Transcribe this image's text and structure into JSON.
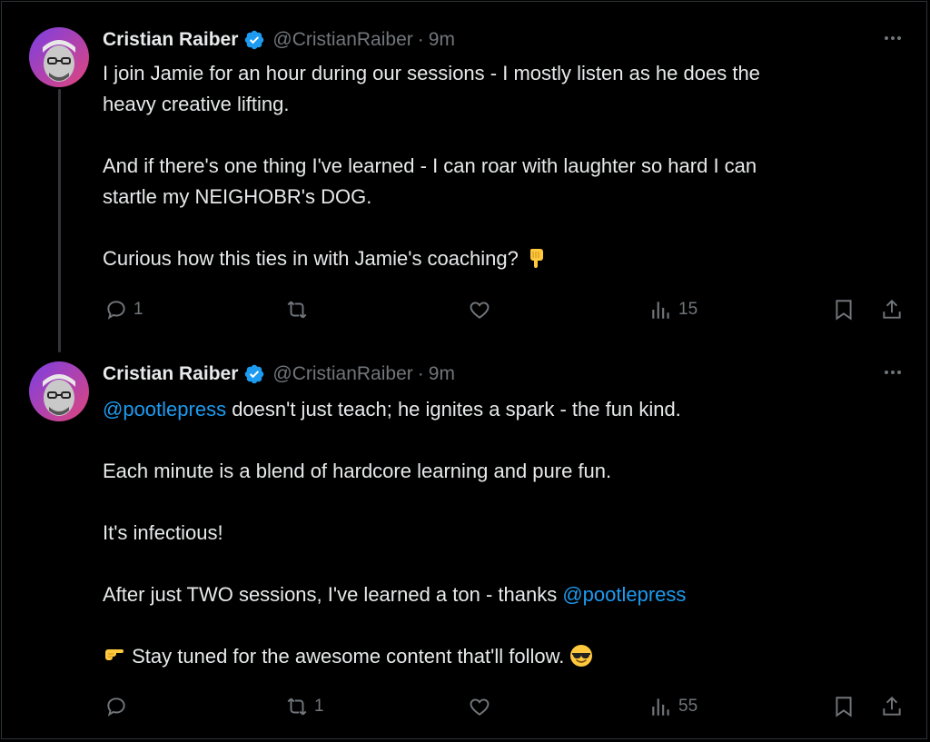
{
  "tweets": [
    {
      "author": "Cristian Raiber",
      "handle": "@CristianRaiber",
      "time": "9m",
      "paragraphs": [
        {
          "parts": [
            "I join Jamie for an hour during our sessions - I mostly listen as he does the",
            "heavy creative lifting."
          ]
        },
        {
          "parts": [
            "And if there's one thing I've learned - I can roar with laughter so hard I can",
            "startle my NEIGHOBR's DOG."
          ]
        },
        {
          "parts": [
            "Curious how this ties in with Jamie's coaching?"
          ]
        }
      ],
      "actions": {
        "replies": "1",
        "reposts": "",
        "likes": "",
        "views": "15"
      }
    },
    {
      "author": "Cristian Raiber",
      "handle": "@CristianRaiber",
      "time": "9m",
      "line1_mention": "@pootlepress",
      "line1_text": " doesn't just teach; he ignites a spark - the fun kind.",
      "line2": "Each minute is a blend of hardcore learning and pure fun.",
      "line3": "It's infectious!",
      "line4_text": "After just TWO sessions, I've learned a ton - thanks ",
      "line4_mention": "@pootlepress",
      "line5": " Stay tuned for the awesome content that'll follow. ",
      "actions": {
        "replies": "",
        "reposts": "1",
        "likes": "",
        "views": "55"
      }
    }
  ],
  "colors": {
    "background": "#000000",
    "text": "#e7e9ea",
    "muted": "#71767b",
    "accent": "#1d9bf0",
    "verified": "#1d9bf0"
  },
  "icons": [
    "reply-icon",
    "repost-icon",
    "like-icon",
    "views-icon",
    "bookmark-icon",
    "share-icon",
    "more-icon",
    "verified-badge-icon",
    "point-down-emoji",
    "point-right-emoji",
    "sunglasses-emoji"
  ]
}
